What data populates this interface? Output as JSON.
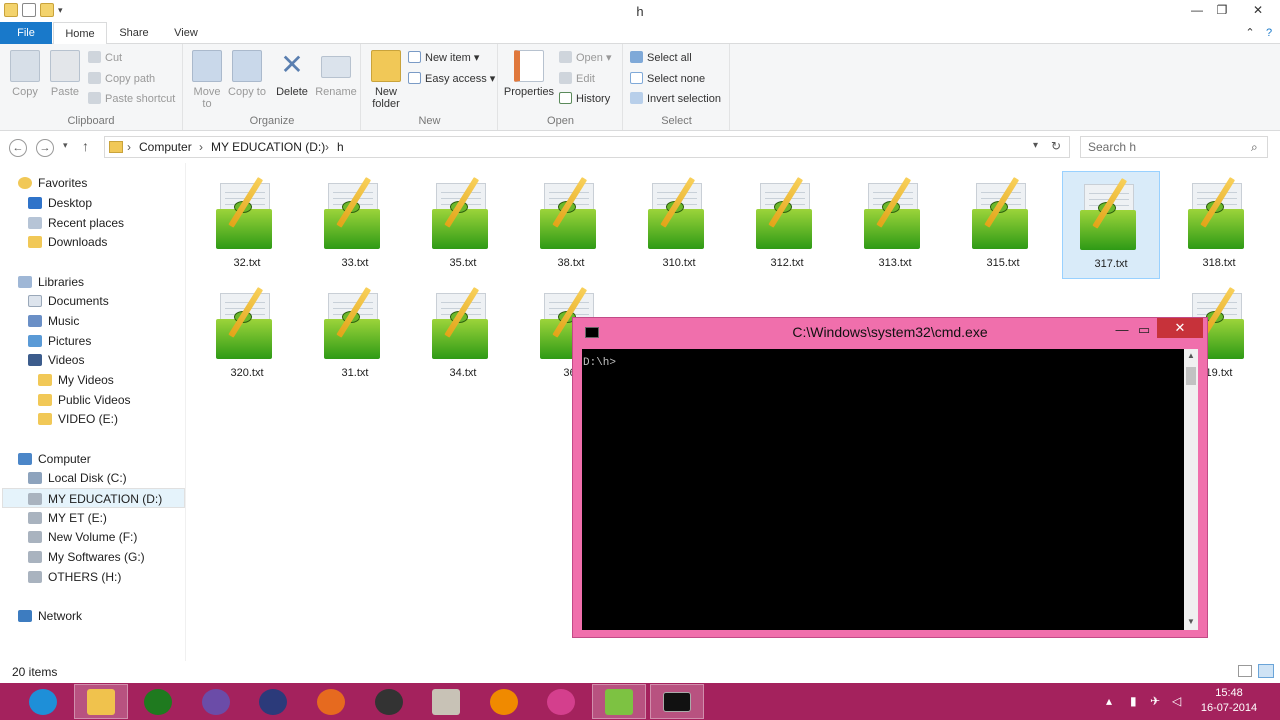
{
  "window": {
    "title": "h",
    "minimize_icon": "minimize-icon",
    "maximize_icon": "maximize-icon",
    "close_icon": "close-icon"
  },
  "ribbon_tabs": [
    "File",
    "Home",
    "Share",
    "View"
  ],
  "ribbon": {
    "clipboard": {
      "label": "Clipboard",
      "copy": "Copy",
      "paste": "Paste",
      "cut": "Cut",
      "copy_path": "Copy path",
      "paste_shortcut": "Paste shortcut"
    },
    "organize": {
      "label": "Organize",
      "move_to": "Move to",
      "copy_to": "Copy to",
      "delete": "Delete",
      "rename": "Rename"
    },
    "new": {
      "label": "New",
      "new_folder": "New folder",
      "new_item": "New item",
      "easy_access": "Easy access"
    },
    "open": {
      "label": "Open",
      "properties": "Properties",
      "open": "Open",
      "edit": "Edit",
      "history": "History"
    },
    "select": {
      "label": "Select",
      "select_all": "Select all",
      "select_none": "Select none",
      "invert_selection": "Invert selection"
    }
  },
  "address": {
    "crumbs": [
      "Computer",
      "MY EDUCATION (D:)",
      "h"
    ],
    "search_placeholder": "Search h"
  },
  "nav_pane": {
    "favorites": {
      "label": "Favorites",
      "items": [
        "Desktop",
        "Recent places",
        "Downloads"
      ]
    },
    "libraries": {
      "label": "Libraries",
      "items": [
        "Documents",
        "Music",
        "Pictures",
        "Videos"
      ],
      "video_children": [
        "My Videos",
        "Public Videos",
        "VIDEO (E:)"
      ]
    },
    "computer": {
      "label": "Computer",
      "items": [
        "Local Disk (C:)",
        "MY EDUCATION (D:)",
        "MY ET (E:)",
        "New Volume (F:)",
        "My Softwares (G:)",
        "OTHERS (H:)"
      ],
      "selected": "MY EDUCATION (D:)"
    },
    "network": {
      "label": "Network"
    }
  },
  "files": {
    "row1": [
      "32.txt",
      "33.txt",
      "35.txt",
      "38.txt",
      "310.txt",
      "312.txt",
      "313.txt",
      "315.txt",
      "317.txt",
      "318.txt"
    ],
    "row2": [
      "320.txt",
      "31.txt",
      "34.txt",
      "36."
    ],
    "row2_right": "19.txt",
    "selected": "317.txt"
  },
  "status": {
    "item_count": "20 items"
  },
  "cmd": {
    "title": "C:\\Windows\\system32\\cmd.exe",
    "prompt": "D:\\h>"
  },
  "taskbar": {
    "apps": [
      "ie-icon",
      "explorer-icon",
      "utorrent-icon",
      "visual-studio-icon",
      "eclipse-icon",
      "firefox-icon",
      "media-player-icon",
      "book-icon",
      "vlc-icon",
      "picasa-icon",
      "notepad-plus-plus-icon",
      "cmd-icon"
    ],
    "time": "15:48",
    "date": "16-07-2014"
  },
  "colors": {
    "accent": "#1979ca",
    "taskbar": "#a4225d",
    "cmd_frame": "#f06fac",
    "cmd_close": "#c7323a"
  }
}
